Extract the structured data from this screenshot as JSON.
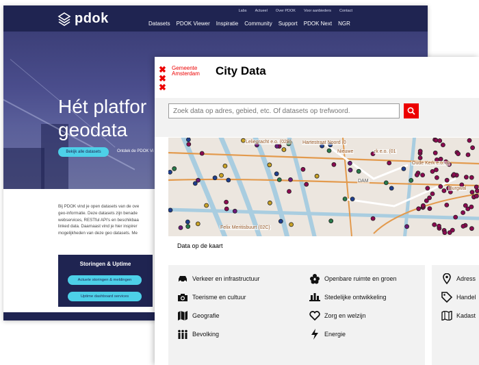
{
  "pdok": {
    "logo": "pdok",
    "utility_nav": [
      "Labs",
      "Actueel",
      "Over PDOK",
      "Voor aanbieders",
      "Contact"
    ],
    "main_nav": [
      "Datasets",
      "PDOK Viewer",
      "Inspiratie",
      "Community",
      "Support",
      "PDOK Next",
      "NGR"
    ],
    "hero_line1": "Hét platfor",
    "hero_line2": "geodata",
    "hero_button": "Bekijk alle datasets",
    "hero_link": "Ontdek de PDOK Vi",
    "intro_lines": [
      "Bij PDOK vind je open datasets van de ove",
      "geo-informatie. Deze datasets zijn benade",
      "webservices, RESTful API's en beschikbaa",
      "linked data. Daarnaast vind je hier inspirer",
      "mogelijkheden van deze geo datasets. Me"
    ],
    "status_title": "Storingen & Uptime",
    "status_btn1": "Actuele storingen & meldingen",
    "status_btn2": "Uptime dashboard services",
    "accent": "#1f2451",
    "button_color": "#4dd0e8"
  },
  "city": {
    "org_line1": "Gemeente",
    "org_line2": "Amsterdam",
    "title": "City Data",
    "search_placeholder": "Zoek data op adres, gebied, etc. Of datasets op trefwoord.",
    "map_caption": "Data op de kaart",
    "map_labels": [
      "Leliegracht e.o. (02E)",
      "Hartestraat Noord (0",
      "Nieuwe",
      "rk e.o. (01",
      "Oude Kerk e.o. (0",
      "Burgwal",
      "Felix Meritisbuurt (02C)",
      "DAM"
    ],
    "categories_col1": [
      {
        "label": "Verkeer en infrastructuur",
        "icon": "car-icon"
      },
      {
        "label": "Toerisme en cultuur",
        "icon": "camera-icon"
      },
      {
        "label": "Geografie",
        "icon": "map-icon"
      },
      {
        "label": "Bevolking",
        "icon": "people-icon"
      }
    ],
    "categories_col2": [
      {
        "label": "Openbare ruimte en groen",
        "icon": "flower-icon"
      },
      {
        "label": "Stedelijke ontwikkeling",
        "icon": "city-icon"
      },
      {
        "label": "Zorg en welzijn",
        "icon": "heart-icon"
      },
      {
        "label": "Energie",
        "icon": "bolt-icon"
      }
    ],
    "categories_col3": [
      {
        "label": "Adress",
        "icon": "location-pin-icon"
      },
      {
        "label": "Handel",
        "icon": "tag-icon"
      },
      {
        "label": "Kadast",
        "icon": "parcel-map-icon"
      }
    ],
    "brand_red": "#ec0000"
  }
}
